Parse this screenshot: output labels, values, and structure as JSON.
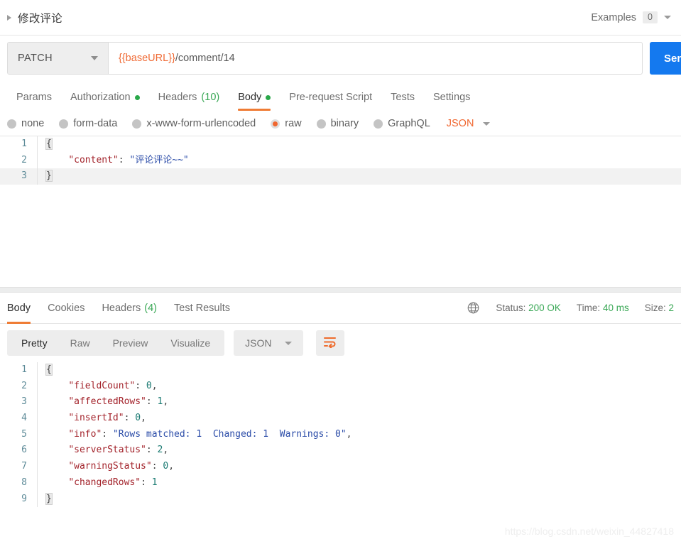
{
  "header": {
    "title": "修改评论",
    "expand_icon": "caret-right-icon",
    "examples_label": "Examples",
    "examples_count": "0",
    "examples_caret": "chevron-down-icon"
  },
  "url_bar": {
    "method": "PATCH",
    "method_caret": "caret-down-icon",
    "url_variable": "{{baseURL}}",
    "url_path": "/comment/14",
    "send_label": "Send",
    "send_color": "#1479ef"
  },
  "request_tabs": [
    {
      "label": "Params",
      "active": false,
      "dot": false,
      "count": ""
    },
    {
      "label": "Authorization",
      "active": false,
      "dot": true,
      "count": ""
    },
    {
      "label": "Headers",
      "active": false,
      "dot": false,
      "count": "(10)"
    },
    {
      "label": "Body",
      "active": true,
      "dot": true,
      "count": ""
    },
    {
      "label": "Pre-request Script",
      "active": false,
      "dot": false,
      "count": ""
    },
    {
      "label": "Tests",
      "active": false,
      "dot": false,
      "count": ""
    },
    {
      "label": "Settings",
      "active": false,
      "dot": false,
      "count": ""
    }
  ],
  "body_types": {
    "options": [
      {
        "label": "none",
        "selected": false
      },
      {
        "label": "form-data",
        "selected": false
      },
      {
        "label": "x-www-form-urlencoded",
        "selected": false
      },
      {
        "label": "raw",
        "selected": true
      },
      {
        "label": "binary",
        "selected": false
      },
      {
        "label": "GraphQL",
        "selected": false
      }
    ],
    "format": "JSON",
    "format_caret": "chevron-down-icon",
    "accent_color": "#f0662f"
  },
  "request_body": {
    "lines": [
      {
        "n": "1",
        "highlight": false,
        "tokens": [
          {
            "t": "{",
            "c": "punc",
            "brace": true
          }
        ]
      },
      {
        "n": "2",
        "highlight": false,
        "tokens": [
          {
            "t": "    ",
            "c": "punc"
          },
          {
            "t": "\"content\"",
            "c": "key"
          },
          {
            "t": ": ",
            "c": "punc"
          },
          {
            "t": "\"评论评论~~\"",
            "c": "str"
          }
        ]
      },
      {
        "n": "3",
        "highlight": true,
        "tokens": [
          {
            "t": "}",
            "c": "punc",
            "brace": true
          }
        ]
      }
    ]
  },
  "response_tabs": [
    {
      "label": "Body",
      "active": true,
      "count": ""
    },
    {
      "label": "Cookies",
      "active": false,
      "count": ""
    },
    {
      "label": "Headers",
      "active": false,
      "count": "(4)"
    },
    {
      "label": "Test Results",
      "active": false,
      "count": ""
    }
  ],
  "response_meta": {
    "globe_icon": "globe-icon",
    "status_label": "Status:",
    "status_value": "200 OK",
    "time_label": "Time:",
    "time_value": "40 ms",
    "size_label": "Size:",
    "size_value": "2",
    "value_color": "#3aa856"
  },
  "response_toolbar": {
    "views": [
      {
        "label": "Pretty",
        "active": true
      },
      {
        "label": "Raw",
        "active": false
      },
      {
        "label": "Preview",
        "active": false
      },
      {
        "label": "Visualize",
        "active": false
      }
    ],
    "format": "JSON",
    "format_caret": "chevron-down-icon",
    "wrap_icon": "word-wrap-icon",
    "wrap_color": "#ee6c2d"
  },
  "response_body": {
    "lines": [
      {
        "n": "1",
        "tokens": [
          {
            "t": "{",
            "c": "punc",
            "brace": true
          }
        ]
      },
      {
        "n": "2",
        "tokens": [
          {
            "t": "    ",
            "c": "punc"
          },
          {
            "t": "\"fieldCount\"",
            "c": "key"
          },
          {
            "t": ": ",
            "c": "punc"
          },
          {
            "t": "0",
            "c": "num"
          },
          {
            "t": ",",
            "c": "punc"
          }
        ]
      },
      {
        "n": "3",
        "tokens": [
          {
            "t": "    ",
            "c": "punc"
          },
          {
            "t": "\"affectedRows\"",
            "c": "key"
          },
          {
            "t": ": ",
            "c": "punc"
          },
          {
            "t": "1",
            "c": "num"
          },
          {
            "t": ",",
            "c": "punc"
          }
        ]
      },
      {
        "n": "4",
        "tokens": [
          {
            "t": "    ",
            "c": "punc"
          },
          {
            "t": "\"insertId\"",
            "c": "key"
          },
          {
            "t": ": ",
            "c": "punc"
          },
          {
            "t": "0",
            "c": "num"
          },
          {
            "t": ",",
            "c": "punc"
          }
        ]
      },
      {
        "n": "5",
        "tokens": [
          {
            "t": "    ",
            "c": "punc"
          },
          {
            "t": "\"info\"",
            "c": "key"
          },
          {
            "t": ": ",
            "c": "punc"
          },
          {
            "t": "\"Rows matched: 1  Changed: 1  Warnings: 0\"",
            "c": "str"
          },
          {
            "t": ",",
            "c": "punc"
          }
        ]
      },
      {
        "n": "6",
        "tokens": [
          {
            "t": "    ",
            "c": "punc"
          },
          {
            "t": "\"serverStatus\"",
            "c": "key"
          },
          {
            "t": ": ",
            "c": "punc"
          },
          {
            "t": "2",
            "c": "num"
          },
          {
            "t": ",",
            "c": "punc"
          }
        ]
      },
      {
        "n": "7",
        "tokens": [
          {
            "t": "    ",
            "c": "punc"
          },
          {
            "t": "\"warningStatus\"",
            "c": "key"
          },
          {
            "t": ": ",
            "c": "punc"
          },
          {
            "t": "0",
            "c": "num"
          },
          {
            "t": ",",
            "c": "punc"
          }
        ]
      },
      {
        "n": "8",
        "tokens": [
          {
            "t": "    ",
            "c": "punc"
          },
          {
            "t": "\"changedRows\"",
            "c": "key"
          },
          {
            "t": ": ",
            "c": "punc"
          },
          {
            "t": "1",
            "c": "num"
          }
        ]
      },
      {
        "n": "9",
        "tokens": [
          {
            "t": "}",
            "c": "punc",
            "brace": true
          }
        ]
      }
    ]
  },
  "watermark": "https://blog.csdn.net/weixin_44827418"
}
